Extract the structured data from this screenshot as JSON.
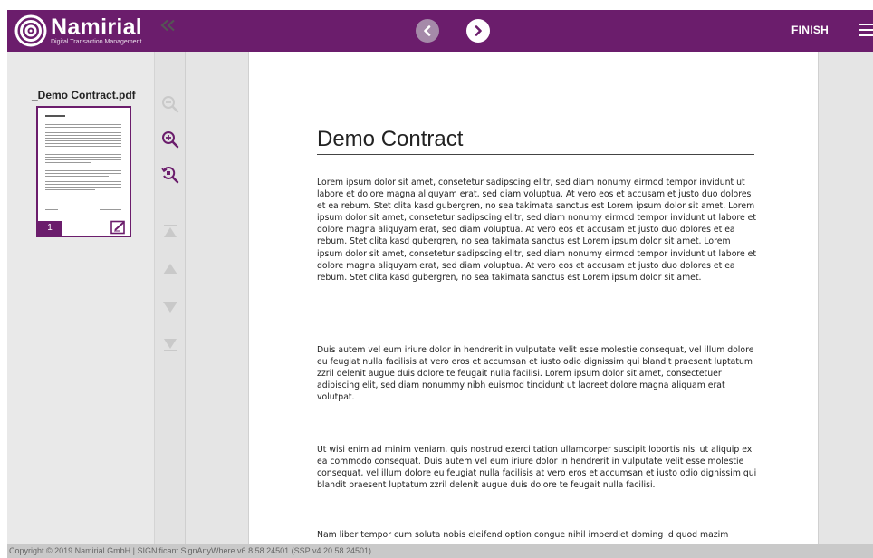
{
  "header": {
    "logo_name": "Namirial",
    "logo_tagline": "Digital Transaction Management",
    "finish_label": "FINISH",
    "prev_icon": "chevron-left-icon",
    "next_icon": "chevron-right-icon",
    "menu_icon": "hamburger-icon"
  },
  "colors": {
    "brand": "#6b1d6c",
    "nav_prev_bg": "#a58aa9",
    "toolbar_icon_active": "#6b1d6c",
    "toolbar_icon_disabled": "#c9c9c9"
  },
  "thumbnails": {
    "file_name": "_Demo Contract.pdf",
    "pages": [
      {
        "number": "1"
      }
    ]
  },
  "toolbar": {
    "items": [
      {
        "icon": "zoom-out-icon",
        "enabled": false
      },
      {
        "icon": "zoom-in-icon",
        "enabled": true
      },
      {
        "icon": "zoom-reset-icon",
        "enabled": true
      },
      {
        "icon": "first-page-icon",
        "enabled": false
      },
      {
        "icon": "previous-page-icon",
        "enabled": false
      },
      {
        "icon": "next-page-icon",
        "enabled": false
      },
      {
        "icon": "last-page-icon",
        "enabled": false
      }
    ]
  },
  "document": {
    "title": "Demo Contract",
    "paragraphs": [
      "Lorem ipsum dolor sit amet, consetetur sadipscing elitr, sed diam nonumy eirmod tempor invidunt ut labore et dolore magna aliquyam erat, sed diam voluptua. At vero eos et accusam et justo duo dolores et ea rebum. Stet clita kasd gubergren, no sea takimata sanctus est Lorem ipsum dolor sit amet. Lorem ipsum dolor sit amet, consetetur sadipscing elitr, sed diam nonumy eirmod tempor invidunt ut labore et dolore magna aliquyam erat, sed diam voluptua. At vero eos et accusam et justo duo dolores et ea rebum. Stet clita kasd gubergren, no sea takimata sanctus est Lorem ipsum dolor sit amet. Lorem ipsum dolor sit amet, consetetur sadipscing elitr, sed diam nonumy eirmod tempor invidunt ut labore et dolore magna aliquyam erat, sed diam voluptua. At vero eos et accusam et justo duo dolores et ea rebum. Stet clita kasd gubergren, no sea takimata sanctus est Lorem ipsum dolor sit amet.",
      "Duis autem vel eum iriure dolor in hendrerit in vulputate velit esse molestie consequat, vel illum dolore eu feugiat nulla facilisis at vero eros et accumsan et iusto odio dignissim qui blandit praesent luptatum zzril delenit augue duis dolore te feugait nulla facilisi. Lorem ipsum dolor sit amet, consectetuer adipiscing elit, sed diam nonummy nibh euismod tincidunt ut laoreet dolore magna aliquam erat volutpat.",
      "Ut wisi enim ad minim veniam, quis nostrud exerci tation ullamcorper suscipit lobortis nisl ut aliquip ex ea commodo consequat. Duis autem vel eum iriure dolor in hendrerit in vulputate velit esse molestie consequat, vel illum dolore eu feugiat nulla facilisis at vero eros et accumsan et iusto odio dignissim qui blandit praesent luptatum zzril delenit augue duis dolore te feugait nulla facilisi.",
      "Nam liber tempor cum soluta nobis eleifend option congue nihil imperdiet doming id quod mazim"
    ]
  },
  "footer": {
    "text": "Copyright © 2019 Namirial GmbH | SIGNificant SignAnyWhere v6.8.58.24501 (SSP v4.20.58.24501)"
  }
}
